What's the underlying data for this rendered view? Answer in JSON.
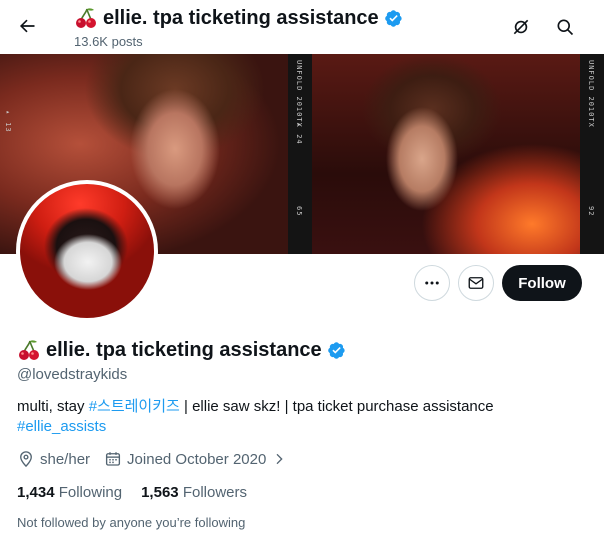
{
  "header": {
    "title": "ellie. tpa ticketing assistance",
    "post_count": "13.6K posts"
  },
  "banner": {
    "film_texts": [
      "▸ 13",
      "UNFOLD 2010TX",
      "▸ 24",
      "65",
      "UNFOLD 2010TX",
      "92"
    ]
  },
  "actions": {
    "follow_label": "Follow"
  },
  "profile": {
    "display_name": "ellie. tpa ticketing assistance",
    "handle": "@lovedstraykids",
    "bio": {
      "part1": "multi, stay ",
      "hashtag1": "#스트레이키즈",
      "part2": " | ellie saw skz! | tpa ticket purchase assistance",
      "hashtag2": "#ellie_assists"
    },
    "pronouns": "she/her",
    "joined": "Joined October 2020",
    "following_count": "1,434",
    "following_label": "Following",
    "followers_count": "1,563",
    "followers_label": "Followers",
    "not_followed_text": "Not followed by anyone you’re following"
  },
  "colors": {
    "accent": "#1d9bf0",
    "text": "#0f1419",
    "secondary_text": "#536471",
    "follow_bg": "#0f1419",
    "border": "#cfd9de"
  },
  "icons": {
    "back": "arrow-left-icon",
    "cherry": "cherry-emoji-icon",
    "verified": "verified-badge-icon",
    "grok": "circle-slash-icon",
    "search": "search-icon",
    "more": "more-icon",
    "message": "mail-icon",
    "location": "location-pin-icon",
    "calendar": "calendar-icon",
    "chevron": "chevron-right-icon"
  }
}
